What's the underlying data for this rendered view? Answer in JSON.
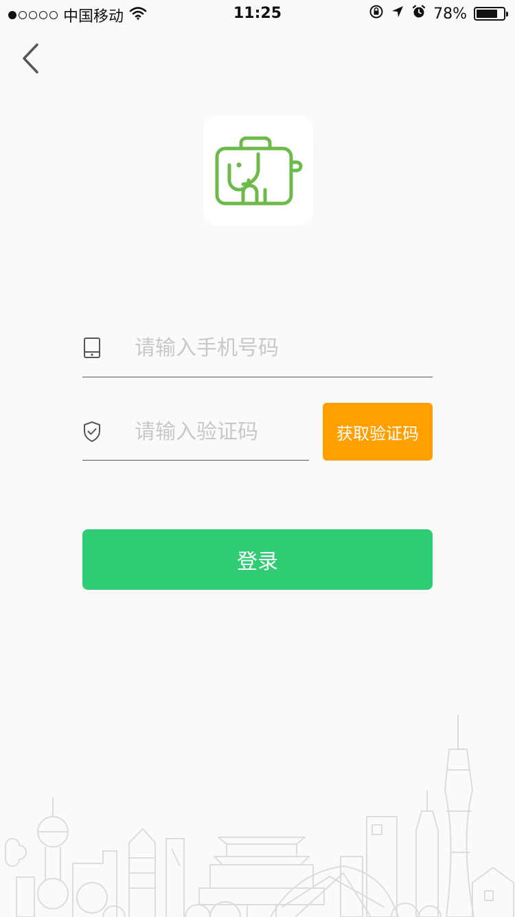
{
  "status_bar": {
    "carrier": "中国移动",
    "time": "11:25",
    "battery": "78%",
    "battery_level": 0.78
  },
  "header": {
    "back_icon": "chevron-left-icon"
  },
  "logo": {
    "icon": "elephant-icon",
    "brand_color": "#6cbb4a"
  },
  "form": {
    "phone": {
      "placeholder": "请输入手机号码",
      "value": "",
      "icon": "phone-icon"
    },
    "code": {
      "placeholder": "请输入验证码",
      "value": "",
      "icon": "shield-check-icon"
    },
    "get_code_label": "获取验证码",
    "login_label": "登录"
  },
  "colors": {
    "accent_orange": "#ff9f00",
    "accent_green": "#2ecd74"
  }
}
